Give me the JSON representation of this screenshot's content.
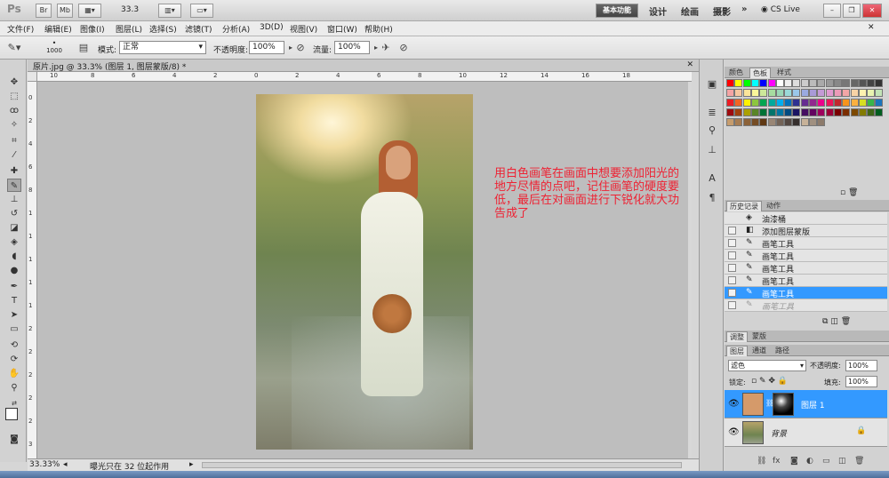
{
  "titlebar": {
    "app_logo": "Ps",
    "buttons": [
      "Br",
      "Mb"
    ],
    "zoom": "33.3",
    "workspaces": [
      "基本功能",
      "设计",
      "绘画",
      "摄影"
    ],
    "more": "»",
    "cs_live": "CS Live"
  },
  "menu": [
    "文件(F)",
    "编辑(E)",
    "图像(I)",
    "图层(L)",
    "选择(S)",
    "滤镜(T)",
    "分析(A)",
    "3D(D)",
    "视图(V)",
    "窗口(W)",
    "帮助(H)"
  ],
  "options": {
    "brush_size": "1000",
    "mode_label": "模式:",
    "mode_value": "正常",
    "opacity_label": "不透明度:",
    "opacity_value": "100%",
    "flow_label": "流量:",
    "flow_value": "100%"
  },
  "document": {
    "tab_title": "原片.jpg @ 33.3% (图层 1, 图层蒙版/8) *",
    "ruler_h": [
      "10",
      "8",
      "6",
      "4",
      "2",
      "0",
      "2",
      "4",
      "6",
      "8",
      "10",
      "12",
      "14",
      "16",
      "18"
    ],
    "ruler_v": [
      "0",
      "2",
      "4",
      "6",
      "8",
      "1",
      "1",
      "1",
      "1",
      "1",
      "2",
      "2",
      "2",
      "2",
      "2",
      "3"
    ],
    "annotation": "用白色画笔在画面中想要添加阳光的地方尽情的点吧，记住画笔的硬度要低，最后在对画面进行下锐化就大功告成了"
  },
  "status": {
    "zoom": "33.33%",
    "message": "曝光只在 32 位起作用"
  },
  "swatch_panel": {
    "tabs": [
      "颜色",
      "色板",
      "样式"
    ],
    "active_tab": "色板"
  },
  "history_panel": {
    "tabs": [
      "历史记录",
      "动作"
    ],
    "items": [
      "油漆桶",
      "添加图层蒙版",
      "画笔工具",
      "画笔工具",
      "画笔工具",
      "画笔工具",
      "画笔工具",
      "画笔工具"
    ],
    "selected_index": 6
  },
  "adjust_panel": {
    "tabs": [
      "调整",
      "蒙版"
    ]
  },
  "layers_panel": {
    "tabs": [
      "图层",
      "通道",
      "路径"
    ],
    "blend_mode": "滤色",
    "opacity_label": "不透明度:",
    "opacity_value": "100%",
    "lock_label": "锁定:",
    "fill_label": "填充:",
    "fill_value": "100%",
    "layers": [
      {
        "name": "图层 1",
        "selected": true
      },
      {
        "name": "背景",
        "selected": false
      }
    ]
  },
  "colors": {
    "accent": "#3399ff",
    "annotation": "#ee2233"
  }
}
